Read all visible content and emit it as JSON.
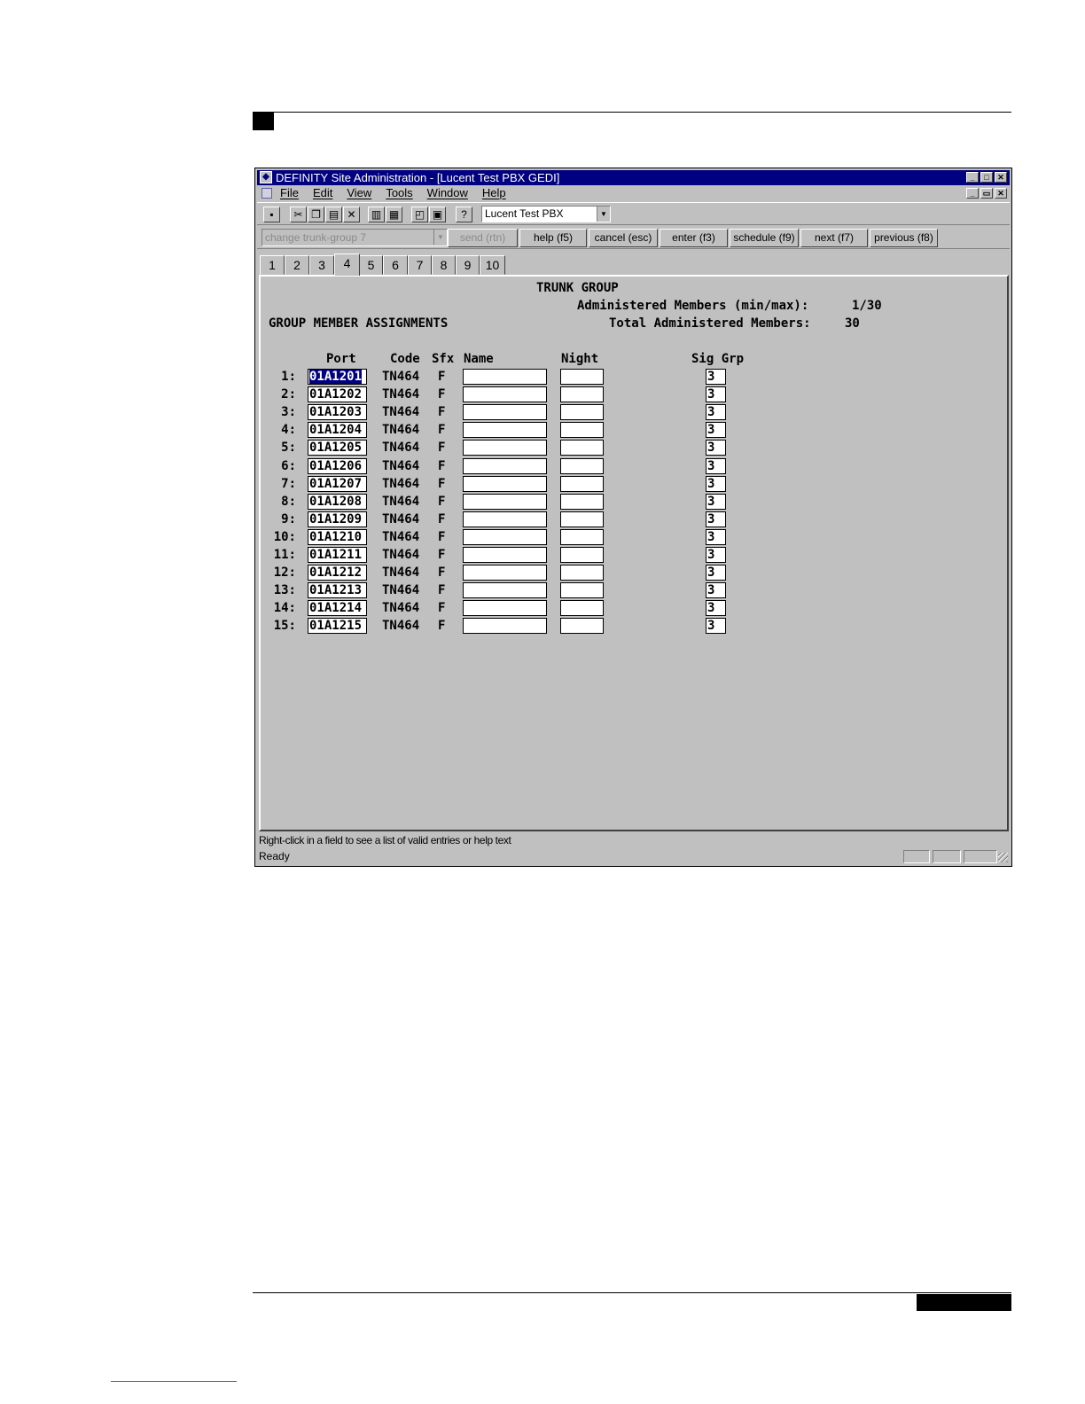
{
  "window": {
    "title": "DEFINITY Site Administration - [Lucent Test PBX GEDI]",
    "min_glyph": "_",
    "max_glyph": "□",
    "restore_glyph": "▭",
    "close_glyph": "✕"
  },
  "menu": [
    "File",
    "Edit",
    "View",
    "Tools",
    "Window",
    "Help"
  ],
  "toolbar": {
    "buttons": [
      "save-icon",
      "cut-icon",
      "copy-icon",
      "paste-icon",
      "delete-icon",
      "form-view-icon",
      "grid-view-icon",
      "print-preview-icon",
      "print-icon",
      "help-icon"
    ],
    "glyphs": {
      "cut": "✂",
      "delete": "✕",
      "help": "?"
    },
    "system_combo": "Lucent Test PBX",
    "combo_arrow": "▼"
  },
  "command": {
    "input": "change trunk-group 7",
    "buttons": [
      "send (rtn)",
      "help (f5)",
      "cancel (esc)",
      "enter (f3)",
      "schedule (f9)",
      "next (f7)",
      "previous (f8)"
    ]
  },
  "tabs": [
    "1",
    "2",
    "3",
    "4",
    "5",
    "6",
    "7",
    "8",
    "9",
    "10"
  ],
  "active_tab": "4",
  "form": {
    "title": "TRUNK GROUP",
    "admin_members_label": "Administered Members (min/max):",
    "admin_members_value": "1/30",
    "section_title": "GROUP MEMBER ASSIGNMENTS",
    "total_members_label": "Total Administered Members:",
    "total_members_value": "30",
    "headers": {
      "port": "Port",
      "code": "Code",
      "sfx": "Sfx",
      "name": "Name",
      "night": "Night",
      "sig_grp": "Sig Grp"
    },
    "rows": [
      {
        "num": "1:",
        "port": "01A1201",
        "code": "TN464",
        "sfx": "F",
        "name": "",
        "night": "",
        "sig": "3"
      },
      {
        "num": "2:",
        "port": "01A1202",
        "code": "TN464",
        "sfx": "F",
        "name": "",
        "night": "",
        "sig": "3"
      },
      {
        "num": "3:",
        "port": "01A1203",
        "code": "TN464",
        "sfx": "F",
        "name": "",
        "night": "",
        "sig": "3"
      },
      {
        "num": "4:",
        "port": "01A1204",
        "code": "TN464",
        "sfx": "F",
        "name": "",
        "night": "",
        "sig": "3"
      },
      {
        "num": "5:",
        "port": "01A1205",
        "code": "TN464",
        "sfx": "F",
        "name": "",
        "night": "",
        "sig": "3"
      },
      {
        "num": "6:",
        "port": "01A1206",
        "code": "TN464",
        "sfx": "F",
        "name": "",
        "night": "",
        "sig": "3"
      },
      {
        "num": "7:",
        "port": "01A1207",
        "code": "TN464",
        "sfx": "F",
        "name": "",
        "night": "",
        "sig": "3"
      },
      {
        "num": "8:",
        "port": "01A1208",
        "code": "TN464",
        "sfx": "F",
        "name": "",
        "night": "",
        "sig": "3"
      },
      {
        "num": "9:",
        "port": "01A1209",
        "code": "TN464",
        "sfx": "F",
        "name": "",
        "night": "",
        "sig": "3"
      },
      {
        "num": "10:",
        "port": "01A1210",
        "code": "TN464",
        "sfx": "F",
        "name": "",
        "night": "",
        "sig": "3"
      },
      {
        "num": "11:",
        "port": "01A1211",
        "code": "TN464",
        "sfx": "F",
        "name": "",
        "night": "",
        "sig": "3"
      },
      {
        "num": "12:",
        "port": "01A1212",
        "code": "TN464",
        "sfx": "F",
        "name": "",
        "night": "",
        "sig": "3"
      },
      {
        "num": "13:",
        "port": "01A1213",
        "code": "TN464",
        "sfx": "F",
        "name": "",
        "night": "",
        "sig": "3"
      },
      {
        "num": "14:",
        "port": "01A1214",
        "code": "TN464",
        "sfx": "F",
        "name": "",
        "night": "",
        "sig": "3"
      },
      {
        "num": "15:",
        "port": "01A1215",
        "code": "TN464",
        "sfx": "F",
        "name": "",
        "night": "",
        "sig": "3"
      }
    ]
  },
  "status": {
    "hint": "Right-click in a field to see a list of valid entries or help text",
    "ready": "Ready"
  },
  "colors": {
    "titlebar": "#000080",
    "chrome": "#c0c0c0",
    "selection": "#000080"
  }
}
